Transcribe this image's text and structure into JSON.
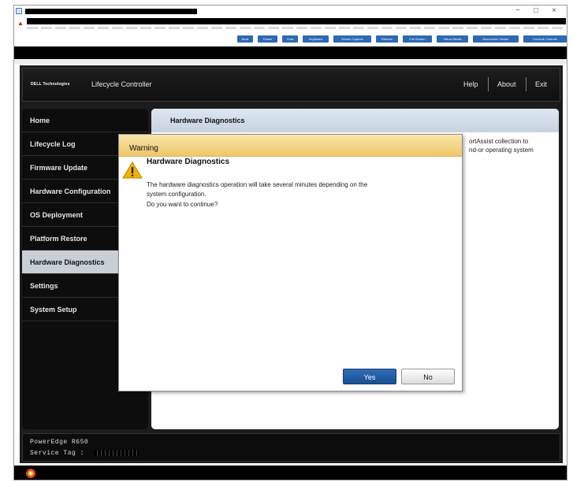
{
  "window": {
    "min_glyph": "−",
    "max_glyph": "□",
    "close_glyph": "×"
  },
  "toolbar": {
    "buttons": [
      "Boot",
      "Power",
      "Chat",
      "Keyboard",
      "Screen Capture",
      "Refresh",
      "Full Screen",
      "Virtual Media",
      "Disconnect Viewer",
      "Console Controls"
    ]
  },
  "lifecycle": {
    "brand": "DELL Technologies",
    "app_title": "Lifecycle Controller",
    "header_links": {
      "help": "Help",
      "about": "About",
      "exit": "Exit"
    }
  },
  "sidebar": {
    "items": [
      {
        "label": "Home",
        "selected": false
      },
      {
        "label": "Lifecycle Log",
        "selected": false
      },
      {
        "label": "Firmware Update",
        "selected": false
      },
      {
        "label": "Hardware Configuration",
        "selected": false
      },
      {
        "label": "OS Deployment",
        "selected": false
      },
      {
        "label": "Platform Restore",
        "selected": false
      },
      {
        "label": "Hardware Diagnostics",
        "selected": true
      },
      {
        "label": "Settings",
        "selected": false
      },
      {
        "label": "System Setup",
        "selected": false
      }
    ]
  },
  "main": {
    "title": "Hardware Diagnostics",
    "bg_line1": "ortAssist collection to",
    "bg_line2": "nd-or operating system"
  },
  "dialog": {
    "title": "Warning",
    "heading": "Hardware Diagnostics",
    "message_lines": [
      "The hardware diagnostics operation will take several minutes depending on the",
      "system configuration.",
      "Do you want to continue?"
    ],
    "yes_label": "Yes",
    "no_label": "No",
    "warning_color": "#f3b200"
  },
  "footer": {
    "model": "PowerEdge R650",
    "service_tag_label": "Service Tag :"
  }
}
